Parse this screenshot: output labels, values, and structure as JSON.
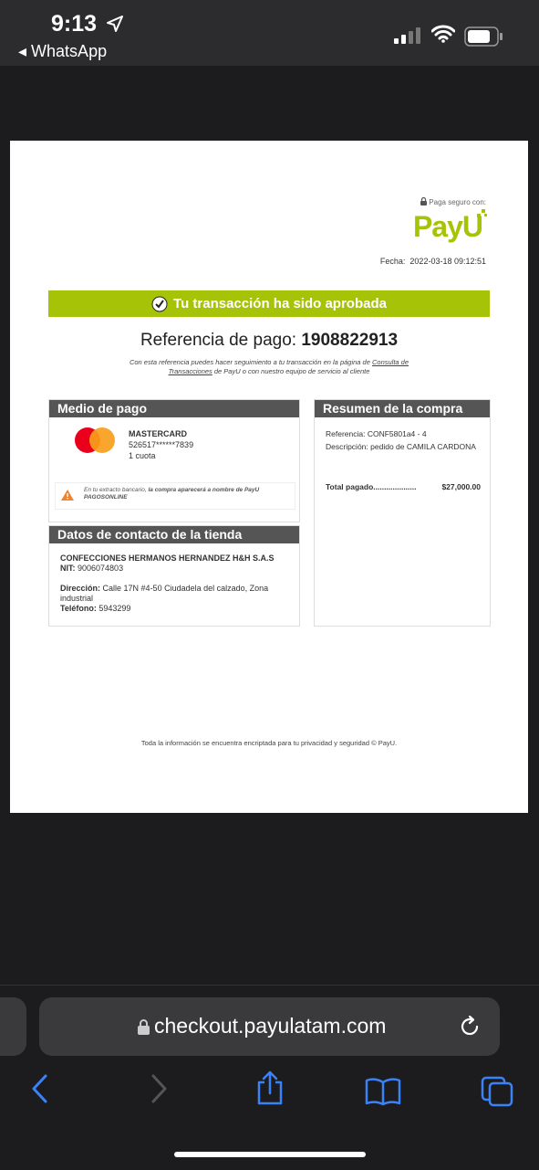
{
  "status_bar": {
    "time": "9:13",
    "back_app": "WhatsApp"
  },
  "page": {
    "secure_label": "Paga seguro con:",
    "brand": "PayU",
    "date_label": "Fecha:",
    "date_value": "2022-03-18  09:12:51",
    "approved_message": "Tu transacción ha sido aprobada",
    "reference_label": "Referencia de pago:",
    "reference_value": "1908822913",
    "reference_note_pre": "Con esta referencia puedes hacer seguimiento a tu transacción en la página de ",
    "reference_note_link": "Consulta de Transacciones",
    "reference_note_post": " de PayU o con nuestro equipo de servicio al cliente",
    "payment_method": {
      "title": "Medio de pago",
      "brand": "MASTERCARD",
      "card_number": "526517******7839",
      "installments": "1 cuota",
      "warning_pre": "En tu extracto bancario, ",
      "warning_bold": "la compra aparecerá a nombre de PayU PAGOSONLINE"
    },
    "store_contact": {
      "title": "Datos de contacto de la tienda",
      "company": "CONFECCIONES HERMANOS HERNANDEZ H&H S.A.S",
      "nit_label": "NIT:",
      "nit_value": "9006074803",
      "address_label": "Dirección:",
      "address_value": "Calle 17N #4-50 Ciudadela del calzado, Zona industrial",
      "phone_label": "Teléfono:",
      "phone_value": "5943299"
    },
    "summary": {
      "title": "Resumen de la compra",
      "reference_label": "Referencia:",
      "reference_value": "CONF5801a4 - 4",
      "description_label": "Descripción:",
      "description_value": "pedido de CAMILA CARDONA",
      "total_label": "Total pagado....................",
      "total_value": "$27,000.00"
    },
    "footer": "Toda la información se encuentra encriptada para tu privacidad y seguridad  © PayU."
  },
  "browser": {
    "url": "checkout.payulatam.com"
  },
  "colors": {
    "accent": "#a6c307",
    "header_gray": "#555555",
    "mastercard_red": "#eb001b",
    "mastercard_orange": "#f79e1b"
  },
  "icons": [
    "location-arrow-icon",
    "signal-icon",
    "wifi-icon",
    "battery-icon",
    "lock-icon",
    "checkmark-icon",
    "warning-icon",
    "reload-icon",
    "back-icon",
    "forward-icon",
    "share-icon",
    "bookmarks-icon",
    "tabs-icon"
  ]
}
